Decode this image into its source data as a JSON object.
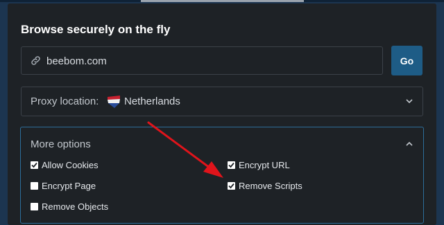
{
  "header": {
    "title": "Browse securely on the fly"
  },
  "url_input": {
    "value": "beebom.com",
    "icon": "link-icon"
  },
  "go_button": {
    "label": "Go"
  },
  "proxy": {
    "label": "Proxy location:",
    "value": "Netherlands",
    "flag_icon": "netherlands-flag-icon"
  },
  "more_options": {
    "title": "More options",
    "options": [
      {
        "label": "Allow Cookies",
        "checked": true
      },
      {
        "label": "Encrypt URL",
        "checked": true
      },
      {
        "label": "Encrypt Page",
        "checked": false
      },
      {
        "label": "Remove Scripts",
        "checked": true
      },
      {
        "label": "Remove Objects",
        "checked": false
      }
    ]
  },
  "colors": {
    "accent": "#1e5c86",
    "panel": "#1e2226",
    "backdrop": "#1c3550",
    "annotation_arrow": "#e0141b"
  }
}
